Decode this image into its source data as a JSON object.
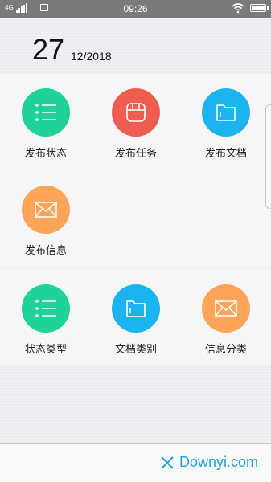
{
  "status_bar": {
    "network": "4G",
    "time": "09:26",
    "icons": [
      "signal-icon",
      "message-icon",
      "wifi-icon",
      "battery-icon"
    ]
  },
  "header": {
    "day": "27",
    "month_year": "12/2018"
  },
  "section1": {
    "items": [
      {
        "label": "发布状态",
        "icon": "list-icon",
        "color": "#1ed29a"
      },
      {
        "label": "发布任务",
        "icon": "calendar-icon",
        "color": "#ee5d4f"
      },
      {
        "label": "发布文档",
        "icon": "folder-icon",
        "color": "#1cb4f0"
      },
      {
        "label": "发布信息",
        "icon": "mail-icon",
        "color": "#ffa458"
      }
    ]
  },
  "section2": {
    "items": [
      {
        "label": "状态类型",
        "icon": "list-icon",
        "color": "#1ed29a"
      },
      {
        "label": "文档类别",
        "icon": "folder-icon",
        "color": "#1cb4f0"
      },
      {
        "label": "信息分类",
        "icon": "mail-icon",
        "color": "#ffa458"
      }
    ]
  },
  "watermark": {
    "text": "Downyi.com"
  }
}
